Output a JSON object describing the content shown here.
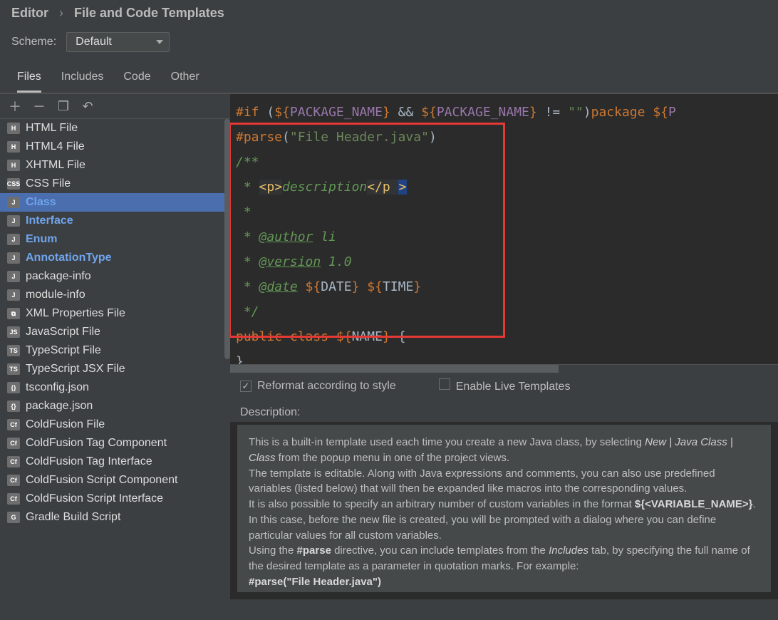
{
  "breadcrumb": {
    "parent": "Editor",
    "current": "File and Code Templates"
  },
  "scheme": {
    "label": "Scheme:",
    "value": "Default"
  },
  "tabs": [
    "Files",
    "Includes",
    "Code",
    "Other"
  ],
  "activeTab": 0,
  "fileList": [
    {
      "label": "HTML File",
      "icon": "H",
      "cls": "ic-h"
    },
    {
      "label": "HTML4 File",
      "icon": "H",
      "cls": "ic-h"
    },
    {
      "label": "XHTML File",
      "icon": "H",
      "cls": "ic-h"
    },
    {
      "label": "CSS File",
      "icon": "CSS",
      "cls": "ic-css"
    },
    {
      "label": "Class",
      "icon": "J",
      "cls": "ic-j",
      "selected": true,
      "bold": true
    },
    {
      "label": "Interface",
      "icon": "J",
      "cls": "ic-j",
      "bold": true
    },
    {
      "label": "Enum",
      "icon": "J",
      "cls": "ic-j",
      "bold": true
    },
    {
      "label": "AnnotationType",
      "icon": "J",
      "cls": "ic-j",
      "bold": true
    },
    {
      "label": "package-info",
      "icon": "J",
      "cls": "ic-j"
    },
    {
      "label": "module-info",
      "icon": "J",
      "cls": "ic-j"
    },
    {
      "label": "XML Properties File",
      "icon": "⧉",
      "cls": "ic-xml"
    },
    {
      "label": "JavaScript File",
      "icon": "JS",
      "cls": "ic-js"
    },
    {
      "label": "TypeScript File",
      "icon": "TS",
      "cls": "ic-ts"
    },
    {
      "label": "TypeScript JSX File",
      "icon": "TS",
      "cls": "ic-ts"
    },
    {
      "label": "tsconfig.json",
      "icon": "{}",
      "cls": "ic-ts"
    },
    {
      "label": "package.json",
      "icon": "{}",
      "cls": "ic-ts"
    },
    {
      "label": "ColdFusion File",
      "icon": "Cf",
      "cls": "ic-cf"
    },
    {
      "label": "ColdFusion Tag Component",
      "icon": "Cf",
      "cls": "ic-cf"
    },
    {
      "label": "ColdFusion Tag Interface",
      "icon": "Cf",
      "cls": "ic-cf"
    },
    {
      "label": "ColdFusion Script Component",
      "icon": "Cf",
      "cls": "ic-cf"
    },
    {
      "label": "ColdFusion Script Interface",
      "icon": "Cf",
      "cls": "ic-cf"
    },
    {
      "label": "Gradle Build Script",
      "icon": "G",
      "cls": "ic-g"
    }
  ],
  "code": {
    "l1a": "#if",
    "l1b": " (",
    "l1c": "${",
    "l1d": "PACKAGE_NAME",
    "l1e": "}",
    "l1f": " && ",
    "l1g": "${",
    "l1h": "PACKAGE_NAME",
    "l1i": "}",
    "l1j": " != ",
    "l1k": "\"\"",
    "l1l": ")",
    "l1m": "package ",
    "l1n": "${",
    "l1o": "P",
    "l2a": "#parse",
    "l2b": "(",
    "l2c": "\"File Header.java\"",
    "l2d": ")",
    "l3": "/**",
    "l4a": " * ",
    "l4b": "<p>",
    "l4c": "description",
    "l4d": "</p ",
    "l4e": ">",
    "l5": " *",
    "l6a": " * ",
    "l6b": "@author",
    "l6c": " li",
    "l7a": " * ",
    "l7b": "@version",
    "l7c": " 1.0",
    "l8a": " * ",
    "l8b": "@date",
    "l8c": " ",
    "l8d": "${",
    "l8e": "DATE",
    "l8f": "}",
    "l8g": " ",
    "l8h": "${",
    "l8i": "TIME",
    "l8j": "}",
    "l9": " */",
    "l10a": "public ",
    "l10b": "class ",
    "l10c": "${",
    "l10d": "NAME",
    "l10e": "}",
    "l10f": " {",
    "l11": "}"
  },
  "options": {
    "reformat": {
      "checked": true,
      "label": "Reformat according to style"
    },
    "liveTemplates": {
      "checked": false,
      "label": "Enable Live Templates"
    }
  },
  "description": {
    "heading": "Description:",
    "p1a": "This is a built-in template used each time you create a new Java class, by selecting ",
    "p1i": "New | Java Class | Class",
    "p1b": " from the popup menu in one of the project views.",
    "p2": "The template is editable. Along with Java expressions and comments, you can also use predefined variables (listed below) that will then be expanded like macros into the corresponding values.",
    "p3a": "It is also possible to specify an arbitrary number of custom variables in the format ",
    "p3b": "${<VARIABLE_NAME>}",
    "p3c": ". In this case, before the new file is created, you will be prompted with a dialog where you can define particular values for all custom variables.",
    "p4a": "Using the ",
    "p4b": "#parse",
    "p4c": " directive, you can include templates from the ",
    "p4i": "Includes",
    "p4d": " tab, by specifying the full name of the desired template as a parameter in quotation marks. For example:",
    "p5": "#parse(\"File Header.java\")"
  }
}
